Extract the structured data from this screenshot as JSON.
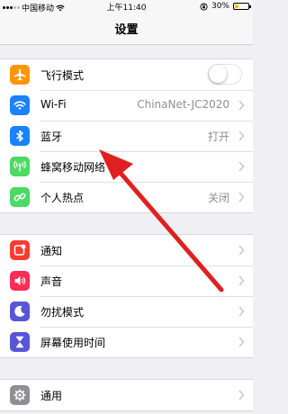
{
  "status_bar": {
    "carrier": "中国移动",
    "time": "上午11:40",
    "battery": "30%",
    "battery_level": 0.3
  },
  "nav": {
    "title": "设置"
  },
  "groups": [
    {
      "rows": [
        {
          "icon": "airplane-icon",
          "icon_color": "#ff9500",
          "label": "飞行模式",
          "control": "toggle",
          "toggle_on": false
        },
        {
          "icon": "wifi-icon",
          "icon_color": "#1a82fb",
          "label": "Wi-Fi",
          "value": "ChinaNet-JC2020"
        },
        {
          "icon": "bluetooth-icon",
          "icon_color": "#1a82fb",
          "label": "蓝牙",
          "value": "打开"
        },
        {
          "icon": "cellular-icon",
          "icon_color": "#4cd964",
          "label": "蜂窝移动网络"
        },
        {
          "icon": "hotspot-icon",
          "icon_color": "#4cd964",
          "label": "个人热点",
          "value": "关闭"
        }
      ]
    },
    {
      "rows": [
        {
          "icon": "notifications-icon",
          "icon_color": "#ff3b30",
          "label": "通知"
        },
        {
          "icon": "sound-icon",
          "icon_color": "#ff2d55",
          "label": "声音"
        },
        {
          "icon": "do-not-disturb-icon",
          "icon_color": "#5856d6",
          "label": "勿扰模式"
        },
        {
          "icon": "screen-time-icon",
          "icon_color": "#5856d6",
          "label": "屏幕使用时间"
        }
      ]
    },
    {
      "rows": [
        {
          "icon": "gear-icon",
          "icon_color": "#8e8e93",
          "label": "通用"
        }
      ]
    }
  ],
  "annotation": {
    "icon": "red-arrow-icon",
    "color": "#e02020"
  }
}
